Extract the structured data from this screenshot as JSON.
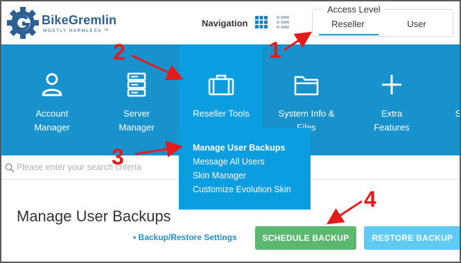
{
  "brand": {
    "name": "BikeGremlin",
    "tagline": "MOSTLY HARMLESS ™"
  },
  "header": {
    "navigation_label": "Navigation",
    "view_icons": [
      "grid-view-icon",
      "list-view-icon"
    ],
    "access_level": {
      "title": "Access Level",
      "options": [
        "Reseller",
        "User"
      ],
      "selected": "Reseller"
    }
  },
  "nav": {
    "items": [
      {
        "label1": "Account",
        "label2": "Manager",
        "icon": "user-icon"
      },
      {
        "label1": "Server",
        "label2": "Manager",
        "icon": "server-icon"
      },
      {
        "label1": "Reseller Tools",
        "label2": "",
        "icon": "briefcase-icon"
      },
      {
        "label1": "System Info &",
        "label2": "Files",
        "icon": "folder-icon"
      },
      {
        "label1": "Extra",
        "label2": "Features",
        "icon": "plus-icon"
      },
      {
        "label1": "S",
        "label2": "",
        "icon": ""
      }
    ],
    "dropdown": [
      "Manage User Backups",
      "Message All Users",
      "Skin Manager",
      "Customize Evolution Skin"
    ]
  },
  "search": {
    "placeholder": "Please enter your search criteria"
  },
  "main": {
    "title": "Manage User Backups",
    "settings_link": "• Backup/Restore Settings",
    "buttons": {
      "schedule": "SCHEDULE BACKUP",
      "restore": "RESTORE BACKUP"
    }
  },
  "annotations": [
    "1",
    "2",
    "3",
    "4"
  ],
  "colors": {
    "nav_blue": "#1892cd",
    "active_blue": "#0a9de0",
    "brand_blue": "#2c5f93",
    "green": "#5cb870",
    "light_blue": "#5fcbf3",
    "annotation_red": "#e31b1b"
  }
}
